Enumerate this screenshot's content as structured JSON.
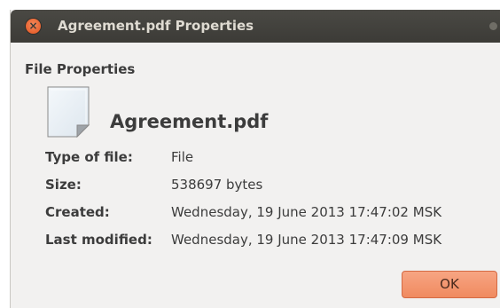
{
  "window": {
    "title": "Agreement.pdf Properties",
    "close_glyph": "×"
  },
  "section_header": "File Properties",
  "file": {
    "name": "Agreement.pdf",
    "icon": "document-icon"
  },
  "properties": [
    {
      "label": "Type of file:",
      "value": "File"
    },
    {
      "label": "Size:",
      "value": "538697 bytes"
    },
    {
      "label": "Created:",
      "value": "Wednesday, 19 June 2013 17:47:02 MSK"
    },
    {
      "label": "Last modified:",
      "value": "Wednesday, 19 June 2013 17:47:09 MSK"
    }
  ],
  "buttons": {
    "ok_label": "OK"
  },
  "colors": {
    "titlebar": "#3c3b37",
    "window_bg": "#f2f1f0",
    "close_button": "#e2521d",
    "ok_button": "#f08a5f"
  }
}
